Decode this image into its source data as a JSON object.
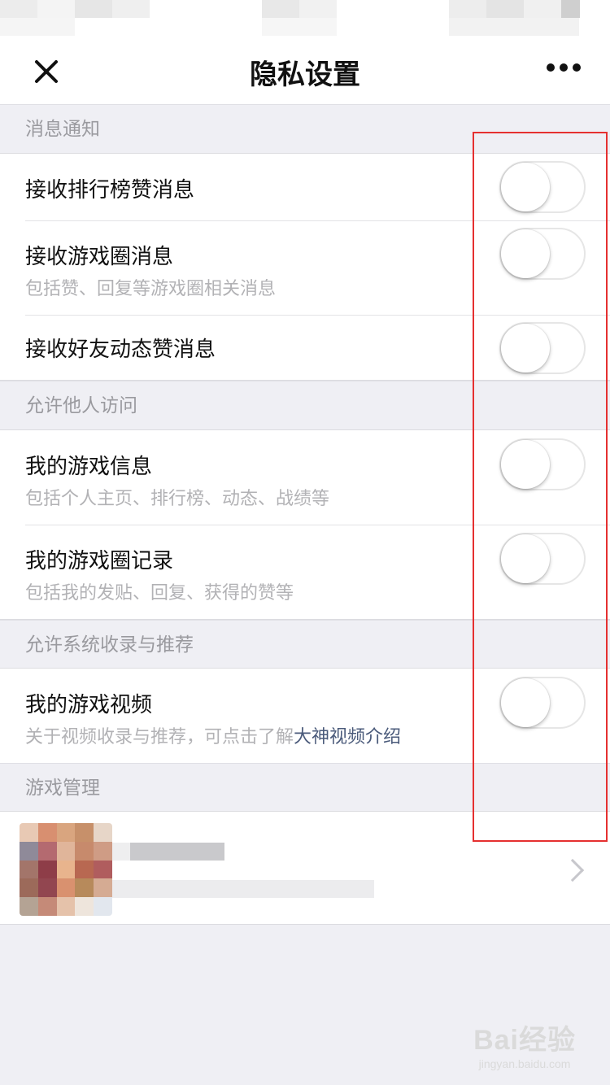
{
  "nav": {
    "title": "隐私设置"
  },
  "sections": [
    {
      "header": "消息通知",
      "items": [
        {
          "title": "接收排行榜赞消息",
          "desc": "",
          "on": false
        },
        {
          "title": "接收游戏圈消息",
          "desc": "包括赞、回复等游戏圈相关消息",
          "on": false
        },
        {
          "title": "接收好友动态赞消息",
          "desc": "",
          "on": false
        }
      ]
    },
    {
      "header": "允许他人访问",
      "items": [
        {
          "title": "我的游戏信息",
          "desc": "包括个人主页、排行榜、动态、战绩等",
          "on": false
        },
        {
          "title": "我的游戏圈记录",
          "desc": "包括我的发贴、回复、获得的赞等",
          "on": false
        }
      ]
    },
    {
      "header": "允许系统收录与推荐",
      "items": [
        {
          "title": "我的游戏视频",
          "desc": "关于视频收录与推荐，可点击了解",
          "link": "大神视频介绍",
          "on": false
        }
      ]
    },
    {
      "header": "游戏管理"
    }
  ],
  "watermark": {
    "main": "Bai经验",
    "sub": "jingyan.baidu.com"
  },
  "colors": {
    "highlight": "#e53030",
    "link": "#4a5a7a",
    "background": "#efeff4"
  }
}
